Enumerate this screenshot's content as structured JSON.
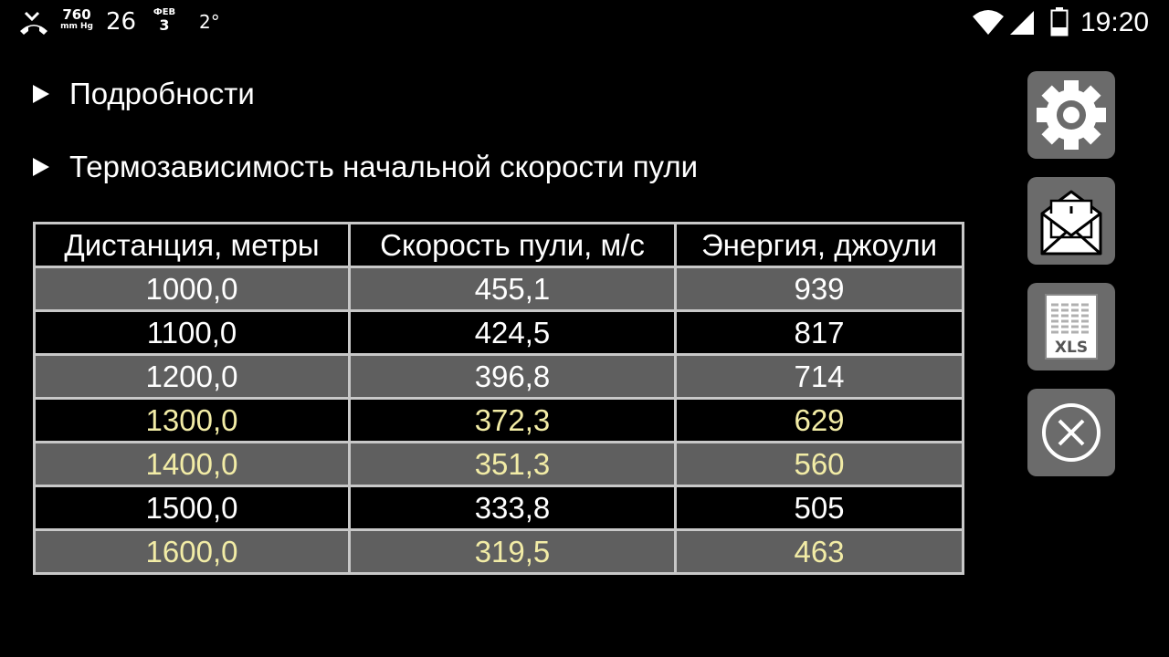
{
  "statusbar": {
    "pressure_value": "760",
    "pressure_unit": "mm Hg",
    "temperature": "26",
    "date_month": "ФЕВ",
    "date_day": "3",
    "degree": "2°",
    "clock": "19:20"
  },
  "sections": [
    {
      "label": "Подробности"
    },
    {
      "label": "Термозависимость начальной скорости пули"
    }
  ],
  "table": {
    "headers": [
      "Дистанция, метры",
      "Скорость пули, м/с",
      "Энергия, джоули"
    ],
    "rows": [
      {
        "distance": "1000,0",
        "speed": "455,1",
        "energy": "939",
        "highlight": false
      },
      {
        "distance": "1100,0",
        "speed": "424,5",
        "energy": "817",
        "highlight": false
      },
      {
        "distance": "1200,0",
        "speed": "396,8",
        "energy": "714",
        "highlight": false
      },
      {
        "distance": "1300,0",
        "speed": "372,3",
        "energy": "629",
        "highlight": true
      },
      {
        "distance": "1400,0",
        "speed": "351,3",
        "energy": "560",
        "highlight": true
      },
      {
        "distance": "1500,0",
        "speed": "333,8",
        "energy": "505",
        "highlight": false
      },
      {
        "distance": "1600,0",
        "speed": "319,5",
        "energy": "463",
        "highlight": true
      }
    ]
  },
  "buttons": {
    "settings_icon": "gear-icon",
    "mail_icon": "mail-download-icon",
    "xls_icon": "xls-icon",
    "xls_label": "XLS",
    "close_icon": "close-icon"
  },
  "colors": {
    "background": "#000000",
    "row_alt": "#5f5f5f",
    "highlight_text": "#f2eca6",
    "button_bg": "#6b6b6b"
  }
}
